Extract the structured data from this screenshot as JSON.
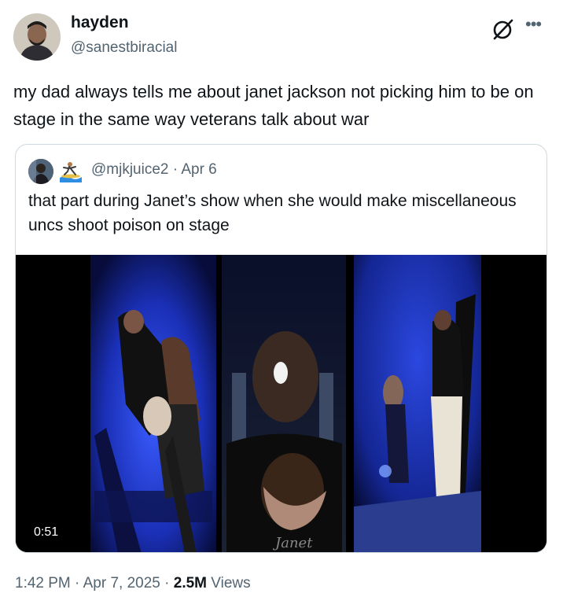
{
  "author": {
    "display_name": "hayden",
    "handle": "@sanestbiracial"
  },
  "tweet": {
    "text": "my dad always tells me about janet jackson not picking him to be on stage in the same way veterans talk about war"
  },
  "quote": {
    "handle": "@mjkjuice2",
    "separator": "·",
    "date": "Apr 6",
    "text": "that part during Janet’s show when she would make miscellaneous uncs shoot poison on stage",
    "video": {
      "duration": "0:51"
    }
  },
  "meta": {
    "time": "1:42 PM",
    "separator": " · ",
    "date": "Apr 7, 2025",
    "views_count": "2.5M",
    "views_label": " Views"
  },
  "icons": {
    "grok": "grok-icon",
    "more": "more-dots-icon",
    "emoji": "surfer-emoji-icon"
  },
  "colors": {
    "text": "#0f1419",
    "secondary": "#536471",
    "border": "#cfd9de",
    "stage_blue": "#1633c8"
  }
}
